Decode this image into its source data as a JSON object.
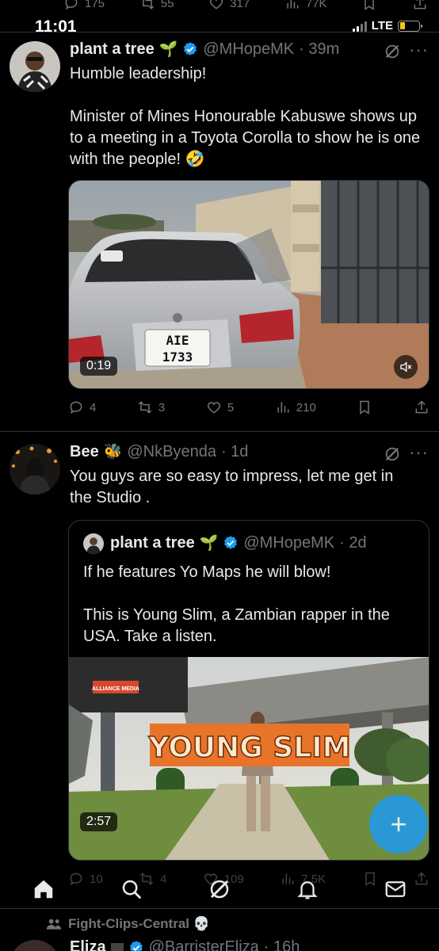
{
  "status_bar": {
    "time": "11:01",
    "network": "LTE"
  },
  "prev_post_actions": {
    "replies": "175",
    "reposts": "55",
    "likes": "317",
    "views": "77K"
  },
  "post1": {
    "name": "plant a tree",
    "handle": "@MHopeMK",
    "time": "· 39m",
    "text_line1": "Humble leadership!",
    "text_line2": "Minister of Mines Honourable Kabuswe shows up to a meeting in a Toyota Corolla to show he is one with the people! 🤣",
    "video_duration": "0:19",
    "plate_line1": "AIE",
    "plate_line2": "1733",
    "actions": {
      "replies": "4",
      "reposts": "3",
      "likes": "5",
      "views": "210"
    }
  },
  "post2": {
    "name": "Bee",
    "handle": "@NkByenda",
    "time": "· 1d",
    "text": "You guys are so easy to impress, let me get in the Studio .",
    "quote": {
      "name": "plant a tree",
      "handle": "@MHopeMK",
      "time": "· 2d",
      "text_line1": "If he features Yo Maps he will blow!",
      "text_line2": "This is Young Slim, a Zambian rapper in the USA. Take a listen.",
      "video_title": "YOUNG SLIM",
      "billboard": "ALLIANCE MEDIA",
      "video_duration": "2:57"
    },
    "actions": {
      "replies": "10",
      "reposts": "4",
      "likes": "109",
      "views": "7.5K"
    }
  },
  "post3": {
    "context": "Fight-Clips-Central 💀",
    "name": "Eliza",
    "handle": "@BarristerEliza",
    "time": "· 16h"
  },
  "fab_label": "+",
  "tabs": [
    "home",
    "search",
    "grok",
    "notifications",
    "messages"
  ],
  "colors": {
    "accent": "#1d9bf0",
    "muted": "#71767b",
    "text": "#e7e9ea",
    "bg": "#000000"
  }
}
